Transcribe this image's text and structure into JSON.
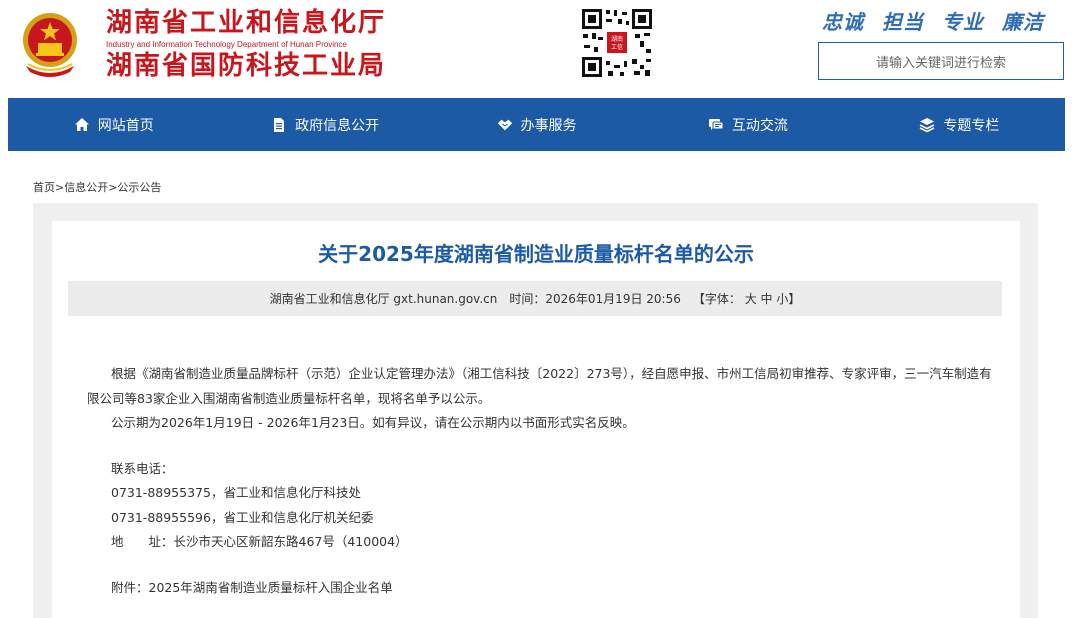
{
  "header": {
    "org_name_1": "湖南省工业和信息化厅",
    "org_name_en": "Industry and Information Technology Department of Hunan Province",
    "org_name_2": "湖南省国防科技工业局",
    "qr_caption": "湖南工信",
    "slogans": [
      "忠诚",
      "担当",
      "专业",
      "廉洁"
    ],
    "search_placeholder": "请输入关键词进行检索"
  },
  "nav": [
    {
      "label": "网站首页",
      "icon": "home-icon"
    },
    {
      "label": "政府信息公开",
      "icon": "document-icon"
    },
    {
      "label": "办事服务",
      "icon": "handshake-icon"
    },
    {
      "label": "互动交流",
      "icon": "chat-icon"
    },
    {
      "label": "专题专栏",
      "icon": "layers-icon"
    }
  ],
  "breadcrumb": "首页>信息公开>公示公告",
  "article": {
    "title": "关于2025年度湖南省制造业质量标杆名单的公示",
    "source": "湖南省工业和信息化厅 gxt.hunan.gov.cn",
    "time": "时间：2026年01月19日 20:56",
    "font_label": "【字体：",
    "font_large": "大",
    "font_medium": "中",
    "font_small": "小】",
    "para1": "根据《湖南省制造业质量品牌标杆（示范）企业认定管理办法》（湘工信科技〔2022〕273号），经自愿申报、市州工信局初审推荐、专家评审，三一汽车制造有限公司等83家企业入围湖南省制造业质量标杆名单，现将名单予以公示。",
    "para2": "公示期为2026年1月19日 - 2026年1月23日。如有异议，请在公示期内以书面形式实名反映。",
    "contact_label": "联系电话：",
    "phone1": "0731-88955375，省工业和信息化厅科技处",
    "phone2": "0731-88955596，省工业和信息化厅机关纪委",
    "address": "地　　址：长沙市天心区新韶东路467号（410004）",
    "attachment": "附件：2025年湖南省制造业质量标杆入围企业名单"
  }
}
